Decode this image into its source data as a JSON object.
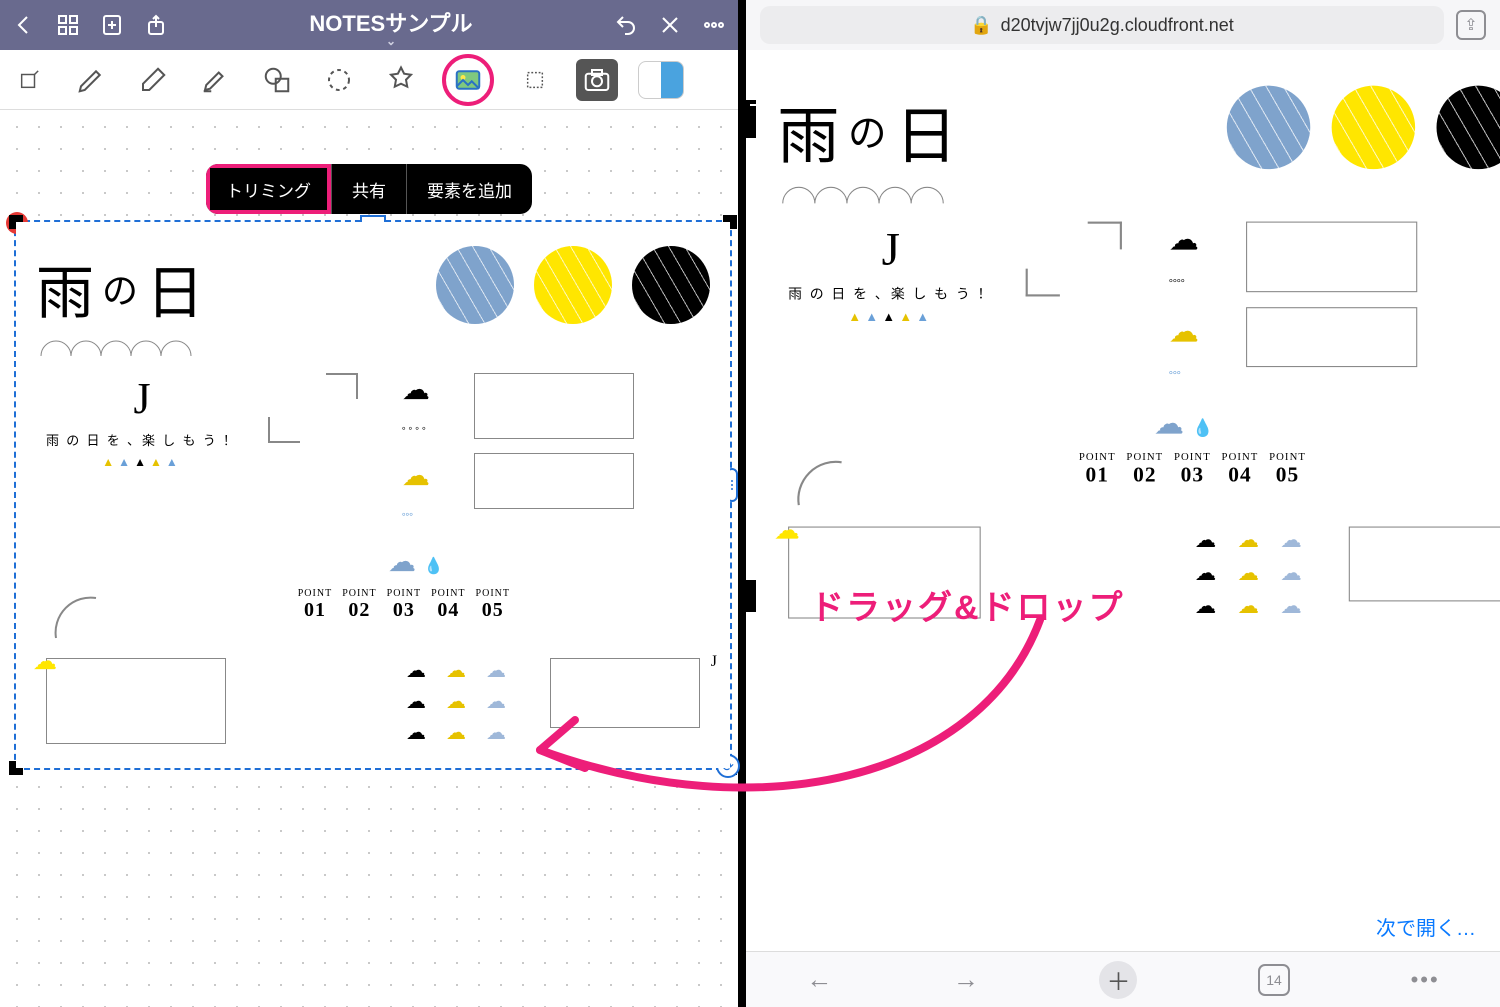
{
  "header": {
    "title": "NOTESサンプル"
  },
  "context_menu": {
    "trim": "トリミング",
    "share": "共有",
    "add_element": "要素を追加"
  },
  "sticker": {
    "title_kanji1": "雨",
    "title_no": "の",
    "title_kanji2": "日",
    "umbrella_letter": "J",
    "umbrella_tag": "雨 の 日 を 、楽 し も う ！",
    "points_label": "POINT",
    "points": [
      "01",
      "02",
      "03",
      "04",
      "05"
    ],
    "box_letter": "J"
  },
  "safari": {
    "url": "d20tvjw7jj0u2g.cloudfront.net",
    "open_with": "次で開く…",
    "tab_count": "14"
  },
  "annotation": {
    "label": "ドラッグ&ドロップ"
  }
}
